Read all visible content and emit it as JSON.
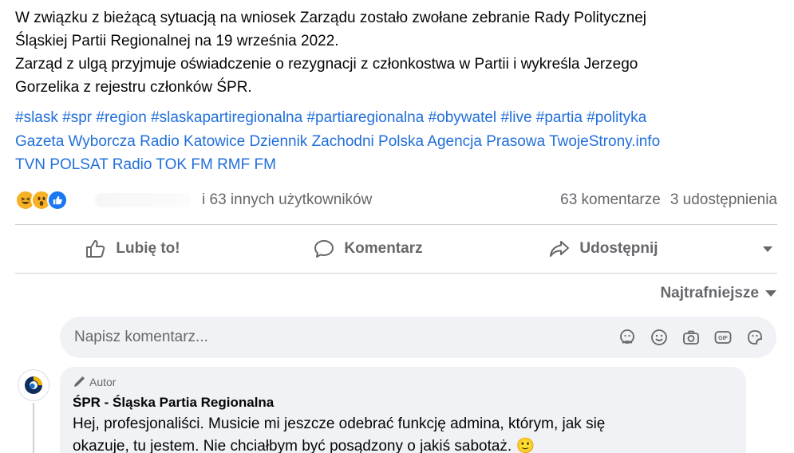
{
  "post": {
    "line1": "W związku z bieżącą sytuacją na wniosek Zarządu zostało zwołane zebranie Rady Politycznej",
    "line2": "Śląskiej Partii Regionalnej na 19 września 2022.",
    "line3": "Zarząd z ulgą przyjmuje oświadczenie o rezygnacji z członkostwa w Partii i wykreśla Jerzego",
    "line4": "Gorzelika z rejestru członków ŚPR."
  },
  "hashtags": [
    "#slask",
    "#spr",
    "#region",
    "#slaskapartiregionalna",
    "#partiaregionalna",
    "#obywatel",
    "#live",
    "#partia",
    "#polityka"
  ],
  "mentions_line1": [
    "Gazeta Wyborcza",
    "Radio Katowice",
    "Dziennik Zachodni",
    "Polska Agencja Prasowa",
    "TwojeStrony.info"
  ],
  "mentions_line2": [
    "TVN",
    "POLSAT",
    "Radio TOK FM",
    "RMF FM"
  ],
  "reactions": {
    "emojis": [
      "haha-icon",
      "wow-icon",
      "like-icon"
    ],
    "others_text": "i 63 innych użytkowników",
    "comments_text": "63 komentarze",
    "shares_text": "3 udostępnienia"
  },
  "actions": {
    "like_label": "Lubię to!",
    "comment_label": "Komentarz",
    "share_label": "Udostępnij"
  },
  "sort": {
    "label": "Najtrafniejsze"
  },
  "comment_input": {
    "placeholder": "Napisz komentarz..."
  },
  "comment": {
    "badge": "Autor",
    "author": "ŚPR - Śląska Partia Regionalna",
    "text_line1": "Hej, profesjonaliści. Musicie mi jeszcze odebrać funkcję admina, którym, jak się",
    "text_line2": "okazuje, tu jestem. Nie chciałbym być posądzony o jakiś sabotaż. 🙂"
  },
  "colors": {
    "link": "#216fdb",
    "secondary_text": "#65676b",
    "bubble_bg": "#f0f2f5",
    "like_blue": "#1877f2",
    "emoji_yellow": "#f7b125"
  }
}
